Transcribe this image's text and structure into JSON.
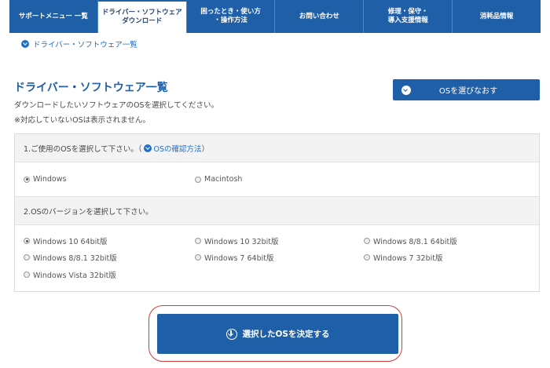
{
  "nav": {
    "tabs": [
      {
        "label": "サポートメニュー 一覧",
        "active": false
      },
      {
        "label": "ドライバー・ソフトウェア\nダウンロード",
        "active": true
      },
      {
        "label": "困ったとき・使い方\n・操作方法",
        "active": false
      },
      {
        "label": "お問い合わせ",
        "active": false
      },
      {
        "label": "修理・保守・\n導入支援情報",
        "active": false
      },
      {
        "label": "消耗品情報",
        "active": false
      }
    ]
  },
  "breadcrumb": {
    "label": "ドライバー・ソフトウェア一覧"
  },
  "page": {
    "title": "ドライバー・ソフトウェア一覧",
    "desc1": "ダウンロードしたいソフトウェアのOSを選択してください。",
    "desc2": "※対応していないOSは表示されません。",
    "reselect_label": "OSを選びなおす"
  },
  "step1": {
    "heading": "1.ご使用のOSを選択して下さい。（",
    "link": "OSの確認方法",
    "heading_end": "）",
    "options": [
      {
        "label": "Windows",
        "checked": true
      },
      {
        "label": "Macintosh",
        "checked": false
      }
    ]
  },
  "step2": {
    "heading": "2.OSのバージョンを選択して下さい。",
    "options": [
      {
        "label": "Windows 10 64bit版",
        "checked": true
      },
      {
        "label": "Windows 10 32bit版",
        "checked": false
      },
      {
        "label": "Windows 8/8.1 64bit版",
        "checked": false
      },
      {
        "label": "Windows 8/8.1 32bit版",
        "checked": false
      },
      {
        "label": "Windows 7 64bit版",
        "checked": false
      },
      {
        "label": "Windows 7 32bit版",
        "checked": false
      },
      {
        "label": "Windows Vista 32bit版",
        "checked": false
      }
    ]
  },
  "confirm": {
    "label": "選択したOSを決定する"
  },
  "colors": {
    "brand": "#1f5fa8",
    "highlight": "#d23a3a"
  }
}
